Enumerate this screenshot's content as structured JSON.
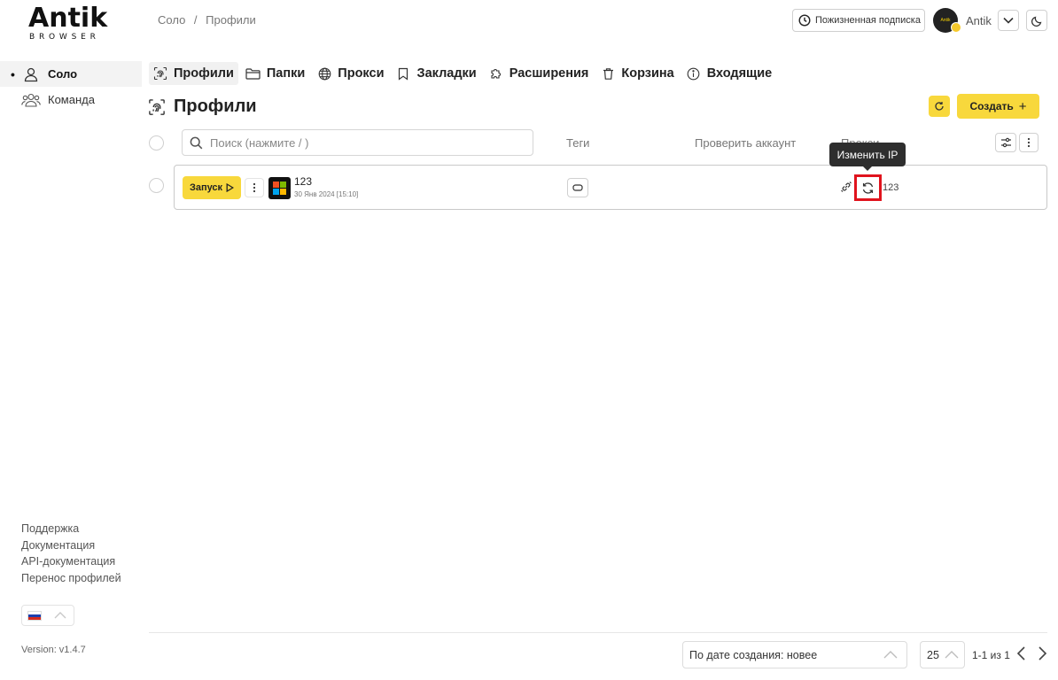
{
  "logo": {
    "main": "Antik",
    "sub": "BROWSER"
  },
  "breadcrumb": {
    "root": "Соло",
    "sep": "/",
    "current": "Профили"
  },
  "header": {
    "subscription_label": "Пожизненная подписка",
    "user_name": "Antik",
    "avatar_text": "Antik"
  },
  "sidebar": {
    "items": [
      {
        "label": "Соло",
        "active": true,
        "icon": "user-icon"
      },
      {
        "label": "Команда",
        "active": false,
        "icon": "team-icon"
      }
    ],
    "links": [
      "Поддержка",
      "Документация",
      "API-документация",
      "Перенос профилей"
    ],
    "version": "Version: v1.4.7"
  },
  "tabs": [
    {
      "label": "Профили",
      "icon": "fingerprint-icon",
      "active": true
    },
    {
      "label": "Папки",
      "icon": "folder-icon",
      "active": false
    },
    {
      "label": "Прокси",
      "icon": "globe-icon",
      "active": false
    },
    {
      "label": "Закладки",
      "icon": "bookmark-icon",
      "active": false
    },
    {
      "label": "Расширения",
      "icon": "puzzle-icon",
      "active": false
    },
    {
      "label": "Корзина",
      "icon": "trash-icon",
      "active": false
    },
    {
      "label": "Входящие",
      "icon": "info-icon",
      "active": false
    }
  ],
  "page": {
    "title": "Профили",
    "create_label": "Создать",
    "create_plus": "+"
  },
  "table": {
    "search_placeholder": "Поиск (нажмите / )",
    "columns": {
      "tags": "Теги",
      "check_account": "Проверить аккаунт",
      "proxy": "Прокси"
    },
    "rows": [
      {
        "launch_label": "Запуск",
        "name": "123",
        "created": "30 Янв 2024 [15:10]",
        "proxy_name": "123"
      }
    ]
  },
  "tooltip": {
    "text": "Изменить IP"
  },
  "footer": {
    "sort_value": "По дате создания: новее",
    "per_page": "25",
    "page_info": "1-1 из 1"
  },
  "colors": {
    "accent": "#f8d83c",
    "highlight": "#e0131d",
    "tooltip_bg": "#2e2e2e"
  }
}
